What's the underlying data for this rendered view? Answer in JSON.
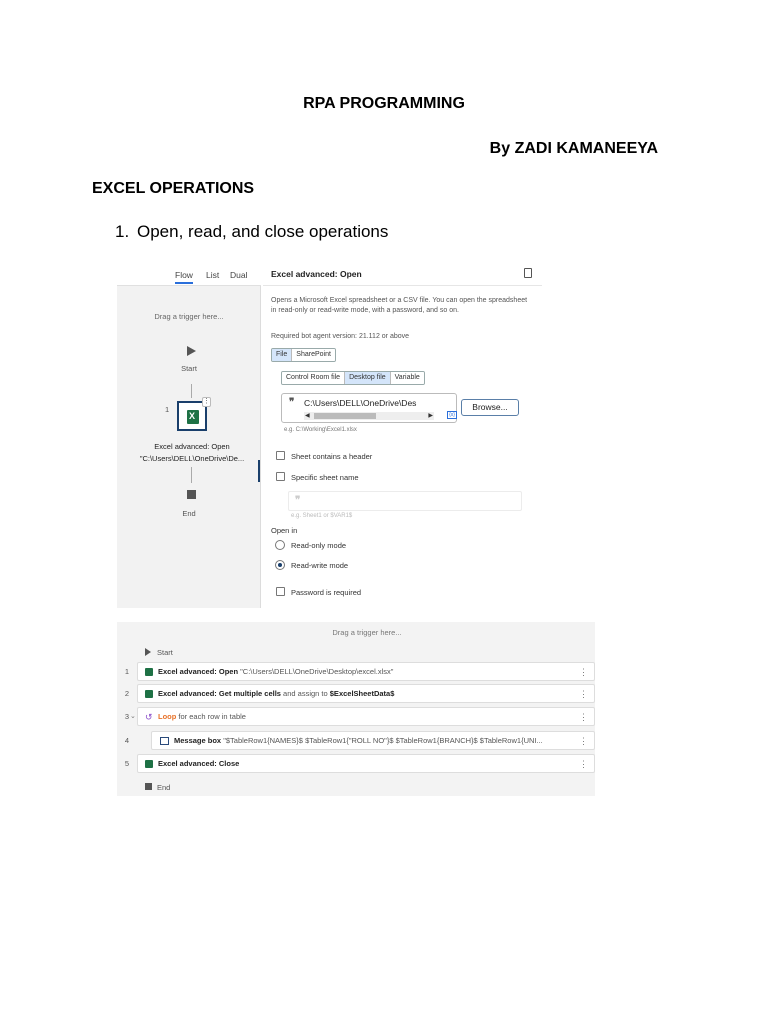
{
  "document": {
    "title": "RPA PROGRAMMING",
    "author": "By ZADI KAMANEEYA",
    "section_heading": "EXCEL OPERATIONS",
    "list_number": "1.",
    "list_item": "Open, read, and close operations"
  },
  "flow_panel": {
    "tabs": [
      "Flow",
      "List",
      "Dual"
    ],
    "active_tab": "Flow",
    "drag_hint": "Drag a trigger here...",
    "start_label": "Start",
    "node_number": "1",
    "node_menu": "⋮",
    "node_title": "Excel advanced: Open",
    "node_subtitle": "\"C:\\Users\\DELL\\OneDrive\\De...",
    "end_label": "End"
  },
  "props_panel": {
    "title": "Excel advanced: Open",
    "description": "Opens a Microsoft Excel spreadsheet or a CSV file. You can open the spreadsheet in read-only or read-write mode, with a password, and so on.",
    "required_version": "Required bot agent version: 21.112 or above",
    "source_tabs": [
      "File",
      "SharePoint"
    ],
    "file_tabs": [
      "Control Room file",
      "Desktop file",
      "Variable"
    ],
    "quote_glyph": "❞",
    "path_value": "C:\\Users\\DELL\\OneDrive\\Des",
    "scroll_left": "◀",
    "scroll_right": "▶",
    "var_icon": "{x}",
    "browse_label": "Browse...",
    "example_path": "e.g. C:\\Working\\Excel1.xlsx",
    "header_checkbox": "Sheet contains a header",
    "sheet_name_checkbox": "Specific sheet name",
    "sheet_example": "e.g. Sheet1 or $VAR1$",
    "open_in_label": "Open in",
    "radio_readonly": "Read-only mode",
    "radio_readwrite": "Read-write mode",
    "selected_mode": "Read-write mode",
    "password_checkbox": "Password is required"
  },
  "list_view": {
    "drag_hint": "Drag a trigger here...",
    "start_label": "Start",
    "end_label": "End",
    "kebab": "⋮",
    "caret": "⌄",
    "loop_glyph": "↺",
    "rows": [
      {
        "num": "1",
        "bold": "Excel advanced: Open",
        "rest": " \"C:\\Users\\DELL\\OneDrive\\Desktop\\excel.xlsx\""
      },
      {
        "num": "2",
        "bold": "Excel advanced: Get multiple cells",
        "rest": " and assign to ",
        "var": "$ExcelSheetData$"
      },
      {
        "num": "3",
        "loop": "Loop",
        "rest": " for each row in table"
      },
      {
        "num": "4",
        "bold": "Message box",
        "rest": " \"$TableRow1{NAMES}$ $TableRow1{\"ROLL NO\"}$ $TableRow1{BRANCH}$ $TableRow1{UNI..."
      },
      {
        "num": "5",
        "bold": "Excel advanced: Close",
        "rest": ""
      }
    ]
  },
  "colors": {
    "excel_green": "#1e7145",
    "selection_blue": "#d4e5fa",
    "loop_orange": "#e8732a",
    "node_border": "#1a3f6b"
  }
}
